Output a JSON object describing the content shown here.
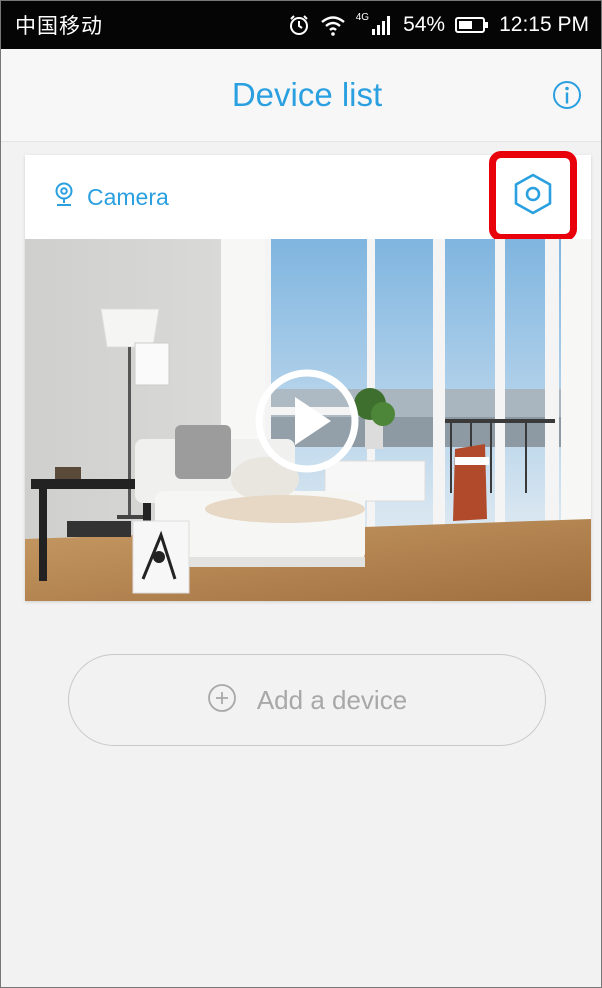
{
  "status_bar": {
    "carrier": "中国移动",
    "network": "4G",
    "battery": "54%",
    "time": "12:15 PM"
  },
  "header": {
    "title": "Device list"
  },
  "device_card": {
    "name": "Camera",
    "accent_color": "#2aa0e0",
    "highlight_color": "#e8000b"
  },
  "add_device": {
    "label": "Add a device"
  },
  "icons": {
    "status": [
      "alarm-icon",
      "wifi-icon",
      "signal-icon",
      "battery-icon"
    ],
    "header": "info-icon",
    "card": [
      "location-pin-icon",
      "gear-icon",
      "play-icon"
    ],
    "add": "plus-circle-icon"
  }
}
